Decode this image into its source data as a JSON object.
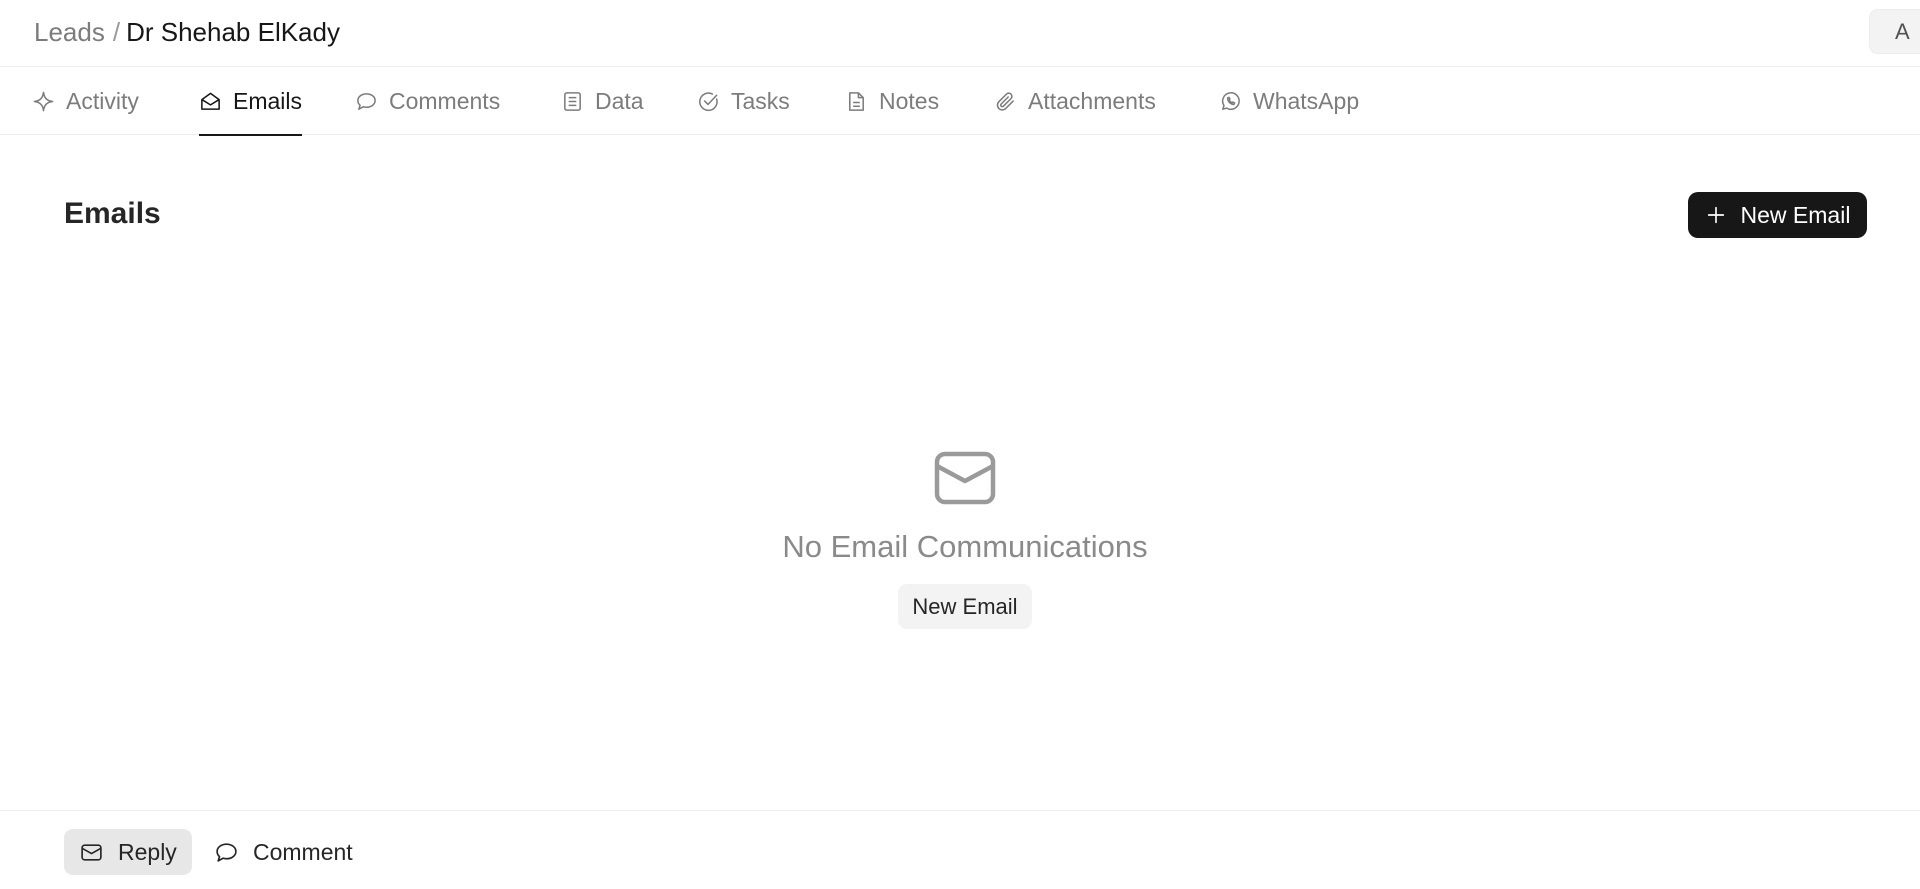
{
  "breadcrumb": {
    "parent": "Leads",
    "separator": "/",
    "current": "Dr Shehab ElKady"
  },
  "header": {
    "right_button_label": "A"
  },
  "tabs": [
    {
      "label": "Activity",
      "icon": "activity-icon",
      "active": false
    },
    {
      "label": "Emails",
      "icon": "mail-open-icon",
      "active": true
    },
    {
      "label": "Comments",
      "icon": "comment-icon",
      "active": false
    },
    {
      "label": "Data",
      "icon": "list-icon",
      "active": false
    },
    {
      "label": "Tasks",
      "icon": "check-circle-icon",
      "active": false
    },
    {
      "label": "Notes",
      "icon": "note-icon",
      "active": false
    },
    {
      "label": "Attachments",
      "icon": "paperclip-icon",
      "active": false
    },
    {
      "label": "WhatsApp",
      "icon": "whatsapp-icon",
      "active": false
    }
  ],
  "main": {
    "title": "Emails",
    "new_email_button": "New Email",
    "empty_state": {
      "icon": "envelope-icon",
      "message": "No Email Communications",
      "button_label": "New Email"
    }
  },
  "footer": {
    "reply_label": "Reply",
    "comment_label": "Comment"
  },
  "colors": {
    "accent": "#171717",
    "muted_text": "#7c7c7c",
    "border": "#ededed"
  }
}
